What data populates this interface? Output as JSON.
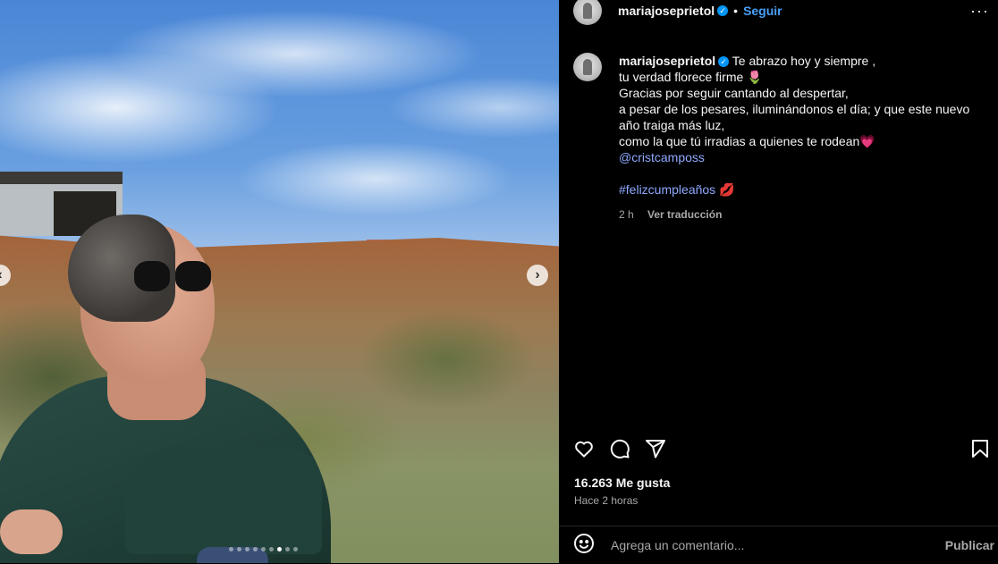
{
  "post": {
    "username": "mariajoseprietol",
    "separator": "•",
    "follow_label": "Seguir",
    "more_label": "···"
  },
  "caption": {
    "username": "mariajoseprietol",
    "line1": "Te abrazo hoy y siempre ,",
    "line2": "tu verdad florece firme",
    "line2_emoji": "🌷",
    "line3": "Gracias por seguir cantando al despertar,",
    "line4": "a pesar de los pesares, iluminándonos el día; y que este nuevo año traiga más luz,",
    "line5": "como la que tú irradias a quienes te rodean",
    "line5_emoji": "💗",
    "mention": "@cristcamposs",
    "hashtag": "#felizcumpleaños",
    "hashtag_emoji": "💋",
    "time": "2 h",
    "translate_label": "Ver traducción"
  },
  "stats": {
    "likes": "16.263 Me gusta",
    "posted": "Hace 2 horas"
  },
  "comment": {
    "placeholder": "Agrega un comentario...",
    "publish_label": "Publicar"
  },
  "carousel": {
    "total_slides": 9,
    "active_slide": 7
  },
  "colors": {
    "accent": "#0095f6",
    "link": "#8fa9ff",
    "background": "#000000"
  },
  "icons": [
    "verified-icon",
    "more-options-icon",
    "heart-icon",
    "comment-icon",
    "share-icon",
    "bookmark-icon",
    "emoji-icon",
    "chevron-left-icon",
    "chevron-right-icon"
  ]
}
